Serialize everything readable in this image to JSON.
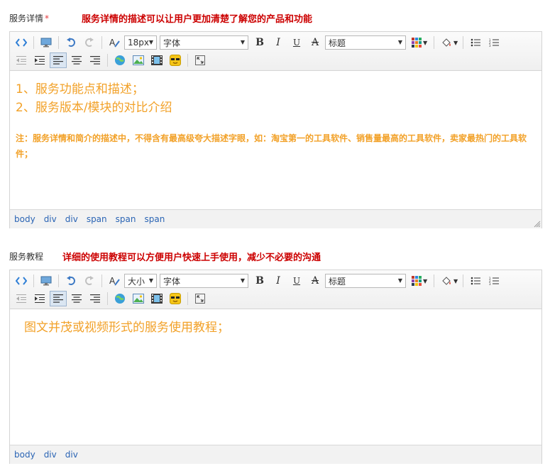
{
  "editors": [
    {
      "label": "服务详情",
      "required_mark": "*",
      "hint": "服务详情的描述可以让用户更加清楚了解您的产品和功能",
      "font_size_value": "18px",
      "font_family_value": "字体",
      "heading_value": "标题",
      "content_lines": [
        "1、服务功能点和描述；",
        "2、服务版本/模块的对比介绍"
      ],
      "note": "注：服务详情和简介的描述中，不得含有最高级夸大描述字眼，如：淘宝第一的工具软件、销售量最高的工具软件，卖家最热门的工具软件；",
      "path": [
        "body",
        "div",
        "div",
        "span",
        "span",
        "span"
      ]
    },
    {
      "label": "服务教程",
      "required_mark": "",
      "hint": "详细的使用教程可以方便用户快速上手使用，减少不必要的沟通",
      "font_size_value": "大小",
      "font_family_value": "字体",
      "heading_value": "标题",
      "content_lines": [
        "图文并茂或视频形式的服务使用教程；"
      ],
      "note": "",
      "path": [
        "body",
        "div",
        "div"
      ]
    }
  ],
  "colors": {
    "content_text": "#f2a128",
    "hint": "#cc0000",
    "required": "#e4393c",
    "path_link": "#2a64b4"
  },
  "icons": {
    "row1": [
      "source-code-icon",
      "preview-icon",
      "undo-icon",
      "redo-icon",
      "clear-format-icon",
      "font-size-select",
      "font-family-select",
      "bold-icon",
      "italic-icon",
      "underline-icon",
      "strikethrough-icon",
      "heading-select",
      "font-color-icon",
      "background-color-icon",
      "unordered-list-icon",
      "ordered-list-icon"
    ],
    "row2": [
      "outdent-icon",
      "indent-icon",
      "align-left-icon",
      "align-center-icon",
      "align-right-icon",
      "link-icon",
      "image-icon",
      "video-icon",
      "emoticon-icon",
      "fullscreen-icon"
    ]
  }
}
